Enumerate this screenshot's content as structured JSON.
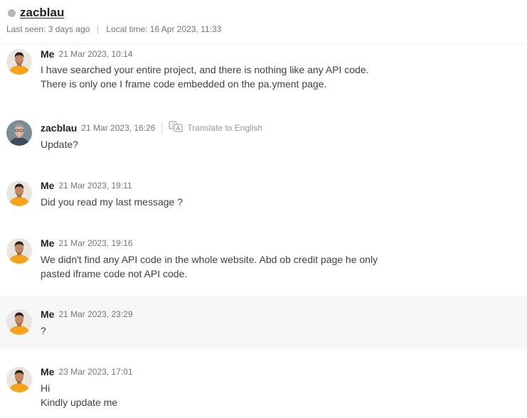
{
  "header": {
    "username": "zacblau",
    "last_seen": "Last seen: 3 days ago",
    "local_time": "Local time: 16 Apr 2023, 11:33"
  },
  "messages": [
    {
      "sender": "Me",
      "time": "21 Mar 2023, 10:14",
      "lines": [
        "I have searched your entire project, and there is nothing like any API code.",
        "There is only one I frame code embedded on the pa.yment page."
      ]
    },
    {
      "sender": "zacblau",
      "time": "21 Mar 2023, 16:26",
      "translate": "Translate to English",
      "lines": [
        "Update?"
      ]
    },
    {
      "sender": "Me",
      "time": "21 Mar 2023, 19:11",
      "lines": [
        "Did you read my last message ?"
      ]
    },
    {
      "sender": "Me",
      "time": "21 Mar 2023, 19:16",
      "lines": [
        "We didn't find any API code in the whole website. Abd ob credit page he only",
        "pasted iframe code not API code."
      ]
    },
    {
      "sender": "Me",
      "time": "21 Mar 2023, 23:29",
      "lines": [
        "?"
      ]
    },
    {
      "sender": "Me",
      "time": "23 Mar 2023, 17:01",
      "lines": [
        "Hi",
        "Kindly update me"
      ]
    }
  ],
  "colors": {
    "online_dot": "#b5b6ba",
    "highlight_row": "#f7f7f7",
    "avatar_me_shirt": "#f5a31a"
  },
  "icons": {
    "translate": "translate-icon"
  }
}
